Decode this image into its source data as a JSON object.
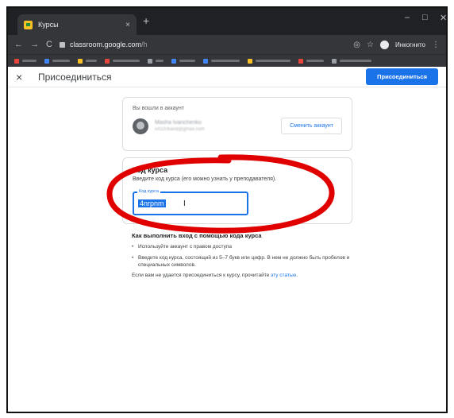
{
  "browser": {
    "tab_title": "Курсы",
    "tab_close": "×",
    "new_tab": "+",
    "url_host": "classroom.google.com",
    "url_path": "/h",
    "incognito_label": "Инкогнито",
    "window_controls": [
      "–",
      "□",
      "✕"
    ]
  },
  "bookmarks": [
    {
      "color": "#e8453c"
    },
    {
      "color": "#4285f4"
    },
    {
      "color": "#f6c026"
    },
    {
      "color": "#e8453c"
    },
    {
      "color": "#9aa0a6"
    },
    {
      "color": "#4285f4"
    },
    {
      "color": "#4285f4"
    },
    {
      "color": "#f6c026"
    },
    {
      "color": "#e8453c"
    },
    {
      "color": "#9aa0a6"
    }
  ],
  "appbar": {
    "close_icon": "×",
    "title": "Присоединиться",
    "join_button": "Присоединиться"
  },
  "account": {
    "signed_in_label": "Вы вошли в аккаунт",
    "name": "Masha Ivanchenko",
    "email": "ivf3206and@gmail.com",
    "switch_button": "Сменить аккаунт"
  },
  "course_code": {
    "title": "Код курса",
    "description": "Введите код курса (его можно узнать у преподавателя).",
    "field_label": "Код курса",
    "field_value": "4nrpnm"
  },
  "instructions": {
    "title": "Как выполнить вход с помощью кода курса",
    "items": [
      "Используйте аккаунт с правом доступа",
      "Введите код курса, состоящий из 5–7 букв или цифр. В нем не должно быть пробелов и специальных символов."
    ],
    "help_text": "Если вам не удается присоединиться к курсу, прочитайте ",
    "help_link": "эту статью",
    "help_end": "."
  },
  "colors": {
    "accent": "#1a73e8",
    "annotation": "#e00000"
  }
}
